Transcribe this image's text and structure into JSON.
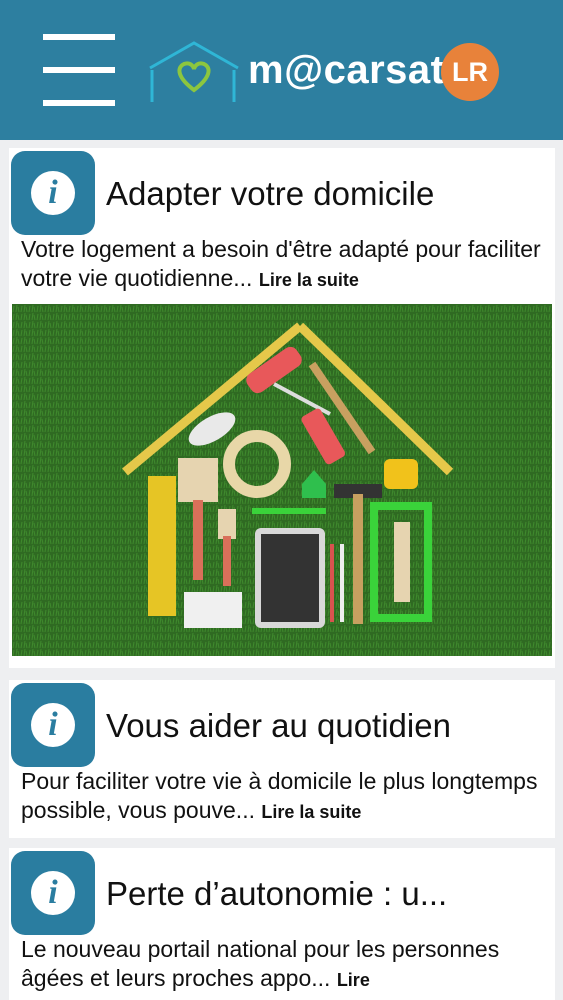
{
  "header": {
    "brand": "m@carsat",
    "badge": "LR",
    "colors": {
      "bar": "#2d7fa0",
      "badge": "#e8823a"
    }
  },
  "cards": [
    {
      "title": "Adapter votre domicile",
      "description": "Votre logement a besoin d'être adapté pour faciliter votre vie quotidienne...",
      "more": "Lire la suite",
      "icon": "info-icon",
      "image": "tools-house-on-grass"
    },
    {
      "title": "Vous aider au quotidien",
      "description": "Pour faciliter votre vie à domicile le plus longtemps possible, vous pouve...",
      "more": "Lire la suite",
      "icon": "info-icon"
    },
    {
      "title": "Perte d’autonomie : u...",
      "description": "Le nouveau portail national pour les personnes âgées et leurs proches appo...",
      "more": "Lire",
      "icon": "info-icon"
    }
  ],
  "icon_letter": "i"
}
